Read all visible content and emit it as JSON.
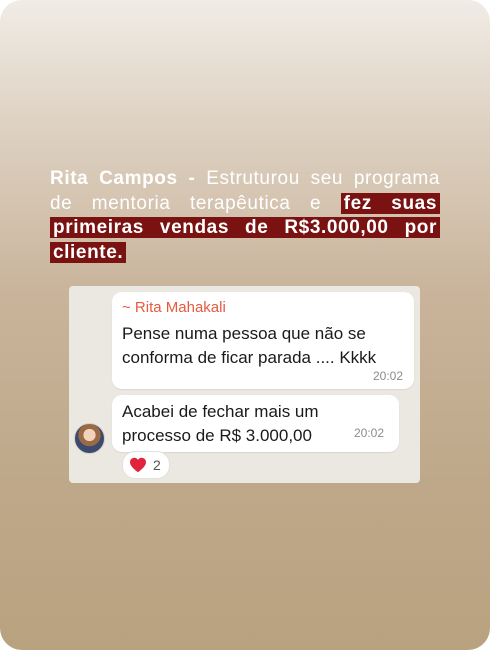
{
  "caption": {
    "name": "Rita Campos -",
    "text": "Estruturou seu programa de mentoria terapêutica e",
    "highlight": "fez suas primeiras vendas de R$3.000,00 por cliente."
  },
  "chat": {
    "message1": {
      "sender": "~ Rita Mahakali",
      "text": "Pense numa pessoa que não se conforma de ficar parada .... Kkkk",
      "time": "20:02"
    },
    "message2": {
      "text": "Acabei de fechar mais um processo de R$ 3.000,00",
      "time": "20:02"
    },
    "reaction": {
      "icon": "red-heart-icon",
      "count": "2"
    }
  },
  "colors": {
    "highlight": "#7a1212",
    "sender": "#e8593f"
  }
}
